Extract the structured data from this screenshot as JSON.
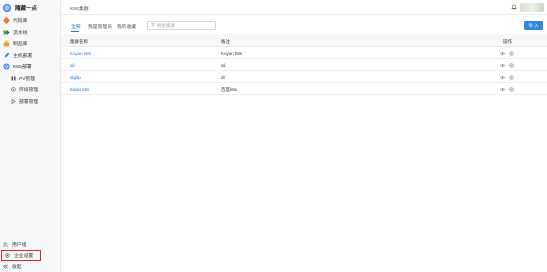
{
  "brand": {
    "name": "隨藏一点",
    "logo_icon": "globe-icon"
  },
  "sidebar": {
    "items": [
      {
        "label": "代码库",
        "icon": "code-repo-icon",
        "color": "#e8743b"
      },
      {
        "label": "流水线",
        "icon": "pipeline-icon",
        "color": "#1aa260"
      },
      {
        "label": "制品库",
        "icon": "artifact-icon",
        "color": "#f0a020"
      },
      {
        "label": "主机部署",
        "icon": "rocket-icon",
        "color": "#3a7afe"
      },
      {
        "label": "K8S部署",
        "icon": "k8s-icon",
        "color": "#3a7afe"
      }
    ],
    "subitems": [
      {
        "label": "PV管理",
        "icon": "pv-icon"
      },
      {
        "label": "环境管理",
        "icon": "environment-icon"
      },
      {
        "label": "部署管理",
        "icon": "deploy-icon"
      }
    ],
    "bottom": [
      {
        "label": "用户组",
        "icon": "user-group-icon"
      },
      {
        "label": "企业设置",
        "icon": "settings-icon"
      },
      {
        "label": "收起",
        "icon": "collapse-icon"
      }
    ]
  },
  "header": {
    "title": "K8S集群"
  },
  "tabs": [
    {
      "label": "全部"
    },
    {
      "label": "我是管理员"
    },
    {
      "label": "我的收藏"
    }
  ],
  "search": {
    "placeholder": "搜索集群"
  },
  "toolbar": {
    "import_label": "导 入"
  },
  "table": {
    "columns": {
      "name": "集群名称",
      "desc": "备注",
      "ops": "操作"
    },
    "rows": [
      {
        "name": "Koyun k8s",
        "desc": "Koyun k8s"
      },
      {
        "name": "ali",
        "desc": "ali"
      },
      {
        "name": "digitp",
        "desc": "dt"
      },
      {
        "name": "baidu k8s",
        "desc": "百度k8s"
      }
    ]
  },
  "colors": {
    "accent": "#2b7bd9",
    "button": "#2f86e5",
    "highlight": "#e0242f"
  }
}
